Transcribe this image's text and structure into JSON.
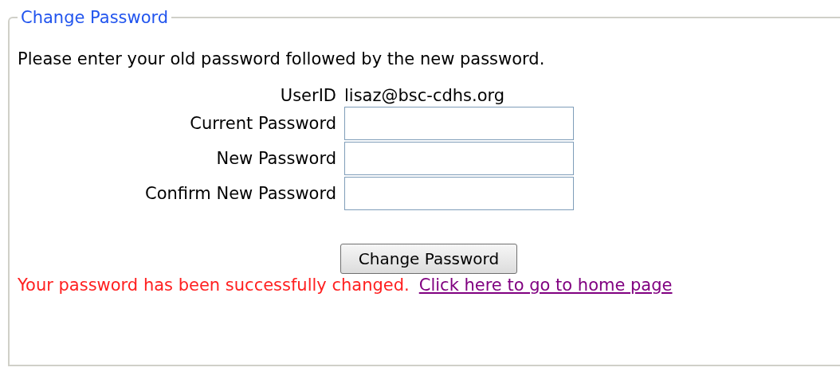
{
  "legend": "Change Password",
  "intro": "Please enter your old password followed by the new password.",
  "fields": [
    {
      "kind": "text",
      "label": "UserID",
      "value": "lisaz@bsc-cdhs.org"
    },
    {
      "kind": "input",
      "label": "Current Password"
    },
    {
      "kind": "input",
      "label": "New Password"
    },
    {
      "kind": "input",
      "label": "Confirm New Password"
    }
  ],
  "button": "Change Password",
  "message": "Your password has been successfully changed.",
  "link": "Click here to go to home page"
}
